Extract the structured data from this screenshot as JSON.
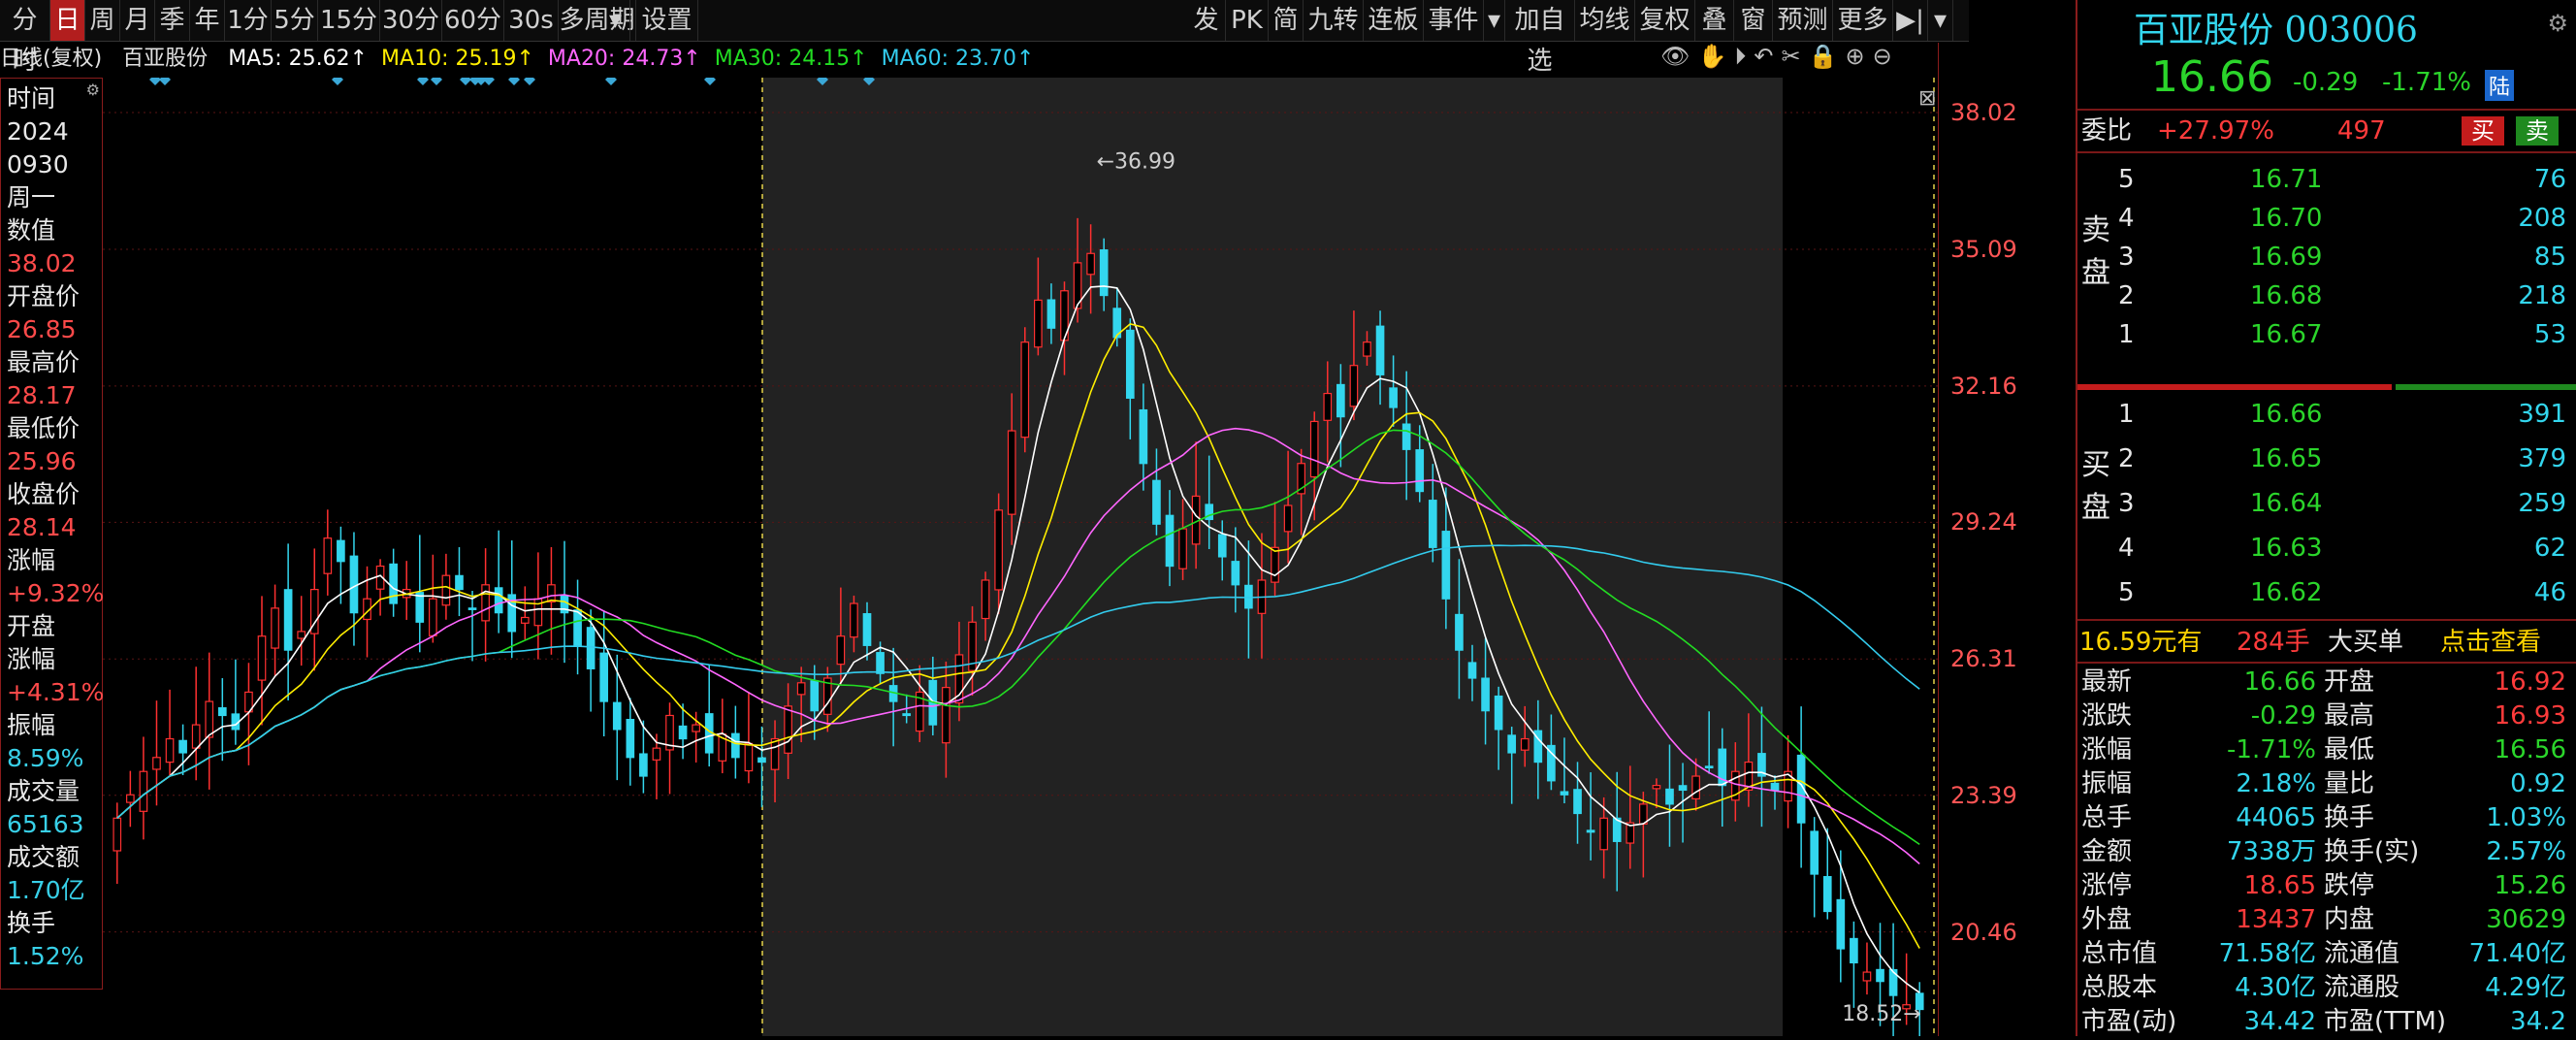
{
  "toolbar": {
    "left_items": [
      "分时",
      "日",
      "周",
      "月",
      "季",
      "年",
      "1分",
      "5分",
      "15分",
      "30分",
      "60分",
      "30s",
      "多周期",
      "设置"
    ],
    "selected_item": "日",
    "right_items": [
      "发",
      "PK",
      "简",
      "九转",
      "连板",
      "事件",
      "加自选",
      "均线",
      "复权",
      "叠",
      "窗",
      "预测",
      "更多"
    ]
  },
  "ma_legend": {
    "prefix": "日线(复权)",
    "name": "百亚股份",
    "items": [
      {
        "label": "MA5: 25.62↑",
        "color": "#ffffff"
      },
      {
        "label": "MA10: 25.19↑",
        "color": "#ffee00"
      },
      {
        "label": "MA20: 24.73↑",
        "color": "#ff66ff"
      },
      {
        "label": "MA30: 24.15↑",
        "color": "#22dd22"
      },
      {
        "label": "MA60: 23.70↑",
        "color": "#33ccee"
      }
    ]
  },
  "left_panel": [
    {
      "text": "时间",
      "cls": "w"
    },
    {
      "text": "2024",
      "cls": "w"
    },
    {
      "text": "0930",
      "cls": "w"
    },
    {
      "text": "周一",
      "cls": "w"
    },
    {
      "text": "数值",
      "cls": "w"
    },
    {
      "text": "38.02",
      "cls": "r"
    },
    {
      "text": "开盘价",
      "cls": "w"
    },
    {
      "text": "26.85",
      "cls": "r"
    },
    {
      "text": "最高价",
      "cls": "w"
    },
    {
      "text": "28.17",
      "cls": "r"
    },
    {
      "text": "最低价",
      "cls": "w"
    },
    {
      "text": "25.96",
      "cls": "r"
    },
    {
      "text": "收盘价",
      "cls": "w"
    },
    {
      "text": "28.14",
      "cls": "r"
    },
    {
      "text": "涨幅",
      "cls": "w"
    },
    {
      "text": "+9.32%",
      "cls": "r"
    },
    {
      "text": "开盘",
      "cls": "w"
    },
    {
      "text": "涨幅",
      "cls": "w"
    },
    {
      "text": "+4.31%",
      "cls": "r"
    },
    {
      "text": "振幅",
      "cls": "w"
    },
    {
      "text": "8.59%",
      "cls": "c"
    },
    {
      "text": "成交量",
      "cls": "w"
    },
    {
      "text": "65163",
      "cls": "c"
    },
    {
      "text": "成交额",
      "cls": "w"
    },
    {
      "text": "1.70亿",
      "cls": "c"
    },
    {
      "text": "换手",
      "cls": "w"
    },
    {
      "text": "1.52%",
      "cls": "c"
    }
  ],
  "right_axis": [
    "38.02",
    "35.09",
    "32.16",
    "29.24",
    "26.31",
    "23.39",
    "20.46"
  ],
  "chart_data": {
    "type": "candlestick",
    "ylim": [
      18.52,
      38.02
    ],
    "max_label": "36.99",
    "min_label": "18.52",
    "closes": [
      22.9,
      23.4,
      23.9,
      24.2,
      24.6,
      24.3,
      24.9,
      25.4,
      25.1,
      24.8,
      25.6,
      26.8,
      27.4,
      26.5,
      26.9,
      27.8,
      28.9,
      28.4,
      27.3,
      27.6,
      28.3,
      27.5,
      27.8,
      27.1,
      27.6,
      28.1,
      27.8,
      27.4,
      27.9,
      27.3,
      26.9,
      27.2,
      27.6,
      27.9,
      27.3,
      26.6,
      26.1,
      25.4,
      24.8,
      24.2,
      23.8,
      24.4,
      25.1,
      24.6,
      24.9,
      24.3,
      24.7,
      24.2,
      24.5,
      24.1,
      24.6,
      25.3,
      25.8,
      25.2,
      25.9,
      26.8,
      27.5,
      26.6,
      26.0,
      25.4,
      25.1,
      25.6,
      24.9,
      25.7,
      26.4,
      27.1,
      28.0,
      29.5,
      31.2,
      33.1,
      34.0,
      33.4,
      34.2,
      34.8,
      35.0,
      34.1,
      33.2,
      31.9,
      30.5,
      29.2,
      28.3,
      29.1,
      29.8,
      29.3,
      28.5,
      27.9,
      27.4,
      28.0,
      28.7,
      29.6,
      30.5,
      31.4,
      32.0,
      31.5,
      32.6,
      33.1,
      32.4,
      31.7,
      30.8,
      29.9,
      28.7,
      27.6,
      26.5,
      25.9,
      25.2,
      24.8,
      24.3,
      24.6,
      24.1,
      23.7,
      23.4,
      23.0,
      22.6,
      22.9,
      22.4,
      22.8,
      23.2,
      23.6,
      23.2,
      23.5,
      23.8,
      24.0,
      23.6,
      23.9,
      24.1,
      23.8,
      23.5,
      23.9,
      22.8,
      21.7,
      20.9,
      20.1,
      19.8,
      19.6,
      19.4,
      19.1,
      18.9,
      18.8
    ]
  },
  "quote": {
    "name": "百亚股份",
    "code": "003006",
    "price": "16.66",
    "change": "-0.29",
    "change_pct": "-1.71%",
    "market_tag": "陆",
    "weibi_label": "委比",
    "weibi_pct": "+27.97%",
    "weibi_num": "497",
    "buy_btn": "买",
    "sell_btn": "卖",
    "sell_label": [
      "卖",
      "盘"
    ],
    "buy_label": [
      "买",
      "盘"
    ],
    "sells": [
      {
        "lvl": "5",
        "price": "16.71",
        "vol": "76"
      },
      {
        "lvl": "4",
        "price": "16.70",
        "vol": "208"
      },
      {
        "lvl": "3",
        "price": "16.69",
        "vol": "85"
      },
      {
        "lvl": "2",
        "price": "16.68",
        "vol": "218"
      },
      {
        "lvl": "1",
        "price": "16.67",
        "vol": "53"
      }
    ],
    "buys": [
      {
        "lvl": "1",
        "price": "16.66",
        "vol": "391"
      },
      {
        "lvl": "2",
        "price": "16.65",
        "vol": "379"
      },
      {
        "lvl": "3",
        "price": "16.64",
        "vol": "259"
      },
      {
        "lvl": "4",
        "price": "16.63",
        "vol": "62"
      },
      {
        "lvl": "5",
        "price": "16.62",
        "vol": "46"
      }
    ],
    "big_order": {
      "price": "16.59元有",
      "qty": "284手",
      "label": "大买单",
      "link": "点击查看"
    },
    "stats": [
      [
        "最新",
        "16.66",
        "g",
        "开盘",
        "16.92",
        "rd"
      ],
      [
        "涨跌",
        "-0.29",
        "g",
        "最高",
        "16.93",
        "rd"
      ],
      [
        "涨幅",
        "-1.71%",
        "g",
        "最低",
        "16.56",
        "g"
      ],
      [
        "振幅",
        "2.18%",
        "cy",
        "量比",
        "0.92",
        "cy"
      ],
      [
        "总手",
        "44065",
        "cy",
        "换手",
        "1.03%",
        "cy"
      ],
      [
        "金额",
        "7338万",
        "cy",
        "换手(实)",
        "2.57%",
        "cy"
      ],
      [
        "涨停",
        "18.65",
        "rd",
        "跌停",
        "15.26",
        "g"
      ],
      [
        "外盘",
        "13437",
        "rd",
        "内盘",
        "30629",
        "g"
      ],
      [
        "总市值",
        "71.58亿",
        "cy",
        "流通值",
        "71.40亿",
        "cy"
      ],
      [
        "总股本",
        "4.30亿",
        "cy",
        "流通股",
        "4.29亿",
        "cy"
      ],
      [
        "市盈(动)",
        "34.42",
        "cy",
        "市盈(TTM)",
        "34.2",
        "cy"
      ]
    ]
  }
}
